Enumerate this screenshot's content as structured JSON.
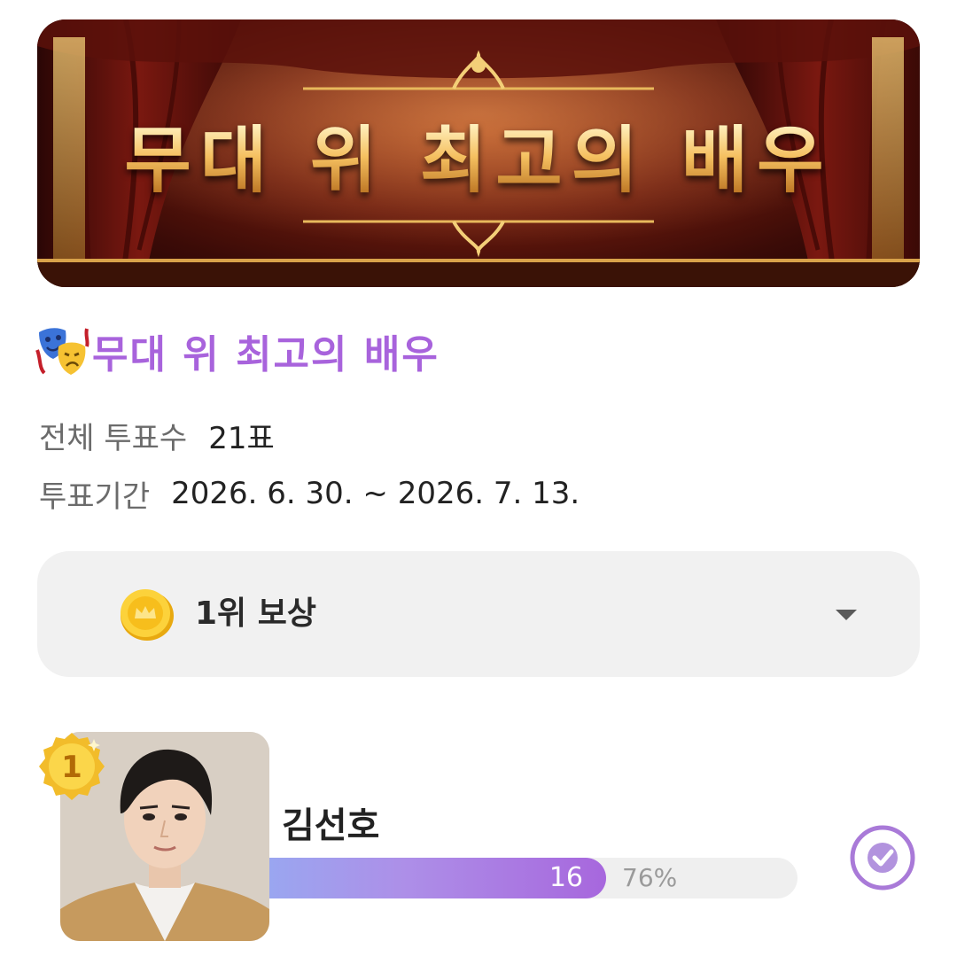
{
  "banner": {
    "title": "무대 위 최고의 배우",
    "colors": {
      "gold": "#f5c060",
      "curtain": "#6a1a0d"
    }
  },
  "heading": {
    "icon": "performing-arts-masks-icon",
    "title": "무대 위 최고의 배우",
    "color": "#a863dc"
  },
  "stats": {
    "total_label": "전체 투표수",
    "total_value": "21표",
    "period_label": "투표기간",
    "period_value": "2026. 6. 30. ~ 2026. 7. 13."
  },
  "reward": {
    "icon": "gold-coin-icon",
    "label": "1위 보상",
    "toggle_icon": "chevron-down-icon"
  },
  "candidates": [
    {
      "rank": "1",
      "name": "김선호",
      "votes": "16",
      "percent_label": "76%",
      "share": 0.76,
      "selected": true,
      "check_icon": "check-circle-icon"
    }
  ]
}
